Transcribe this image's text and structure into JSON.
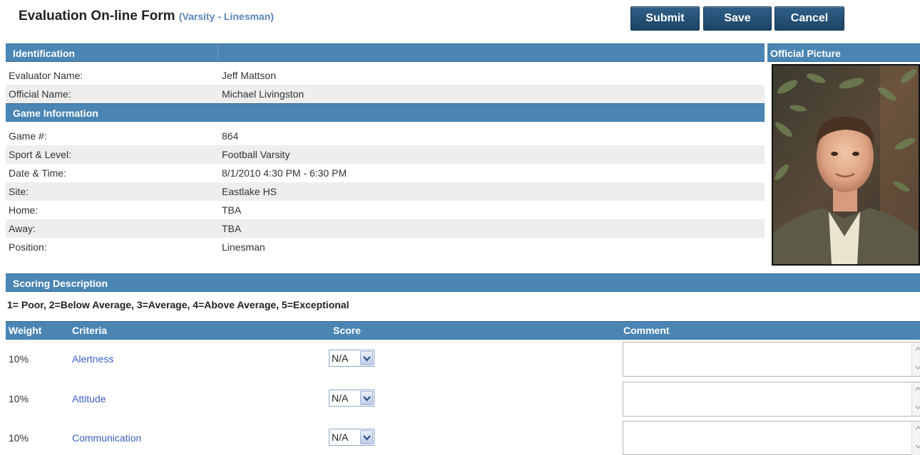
{
  "header": {
    "title": "Evaluation On-line Form",
    "subtitle_open": "(",
    "subtitle_sport": "Varsity",
    "subtitle_sep": " - ",
    "subtitle_position": "Linesman",
    "subtitle_close": ")"
  },
  "actions": {
    "submit_label": "Submit",
    "save_label": "Save",
    "cancel_label": "Cancel"
  },
  "identification": {
    "section_title": "Identification",
    "rows": [
      {
        "label": "Evaluator Name:",
        "value": "Jeff Mattson"
      },
      {
        "label": "Official Name:",
        "value": "Michael Livingston"
      }
    ]
  },
  "game_information": {
    "section_title": "Game Information",
    "rows": [
      {
        "label": "Game #:",
        "value": "864"
      },
      {
        "label": "Sport & Level:",
        "value": "Football Varsity"
      },
      {
        "label": "Date & Time:",
        "value": "8/1/2010 4:30 PM - 6:30 PM"
      },
      {
        "label": "Site:",
        "value": "Eastlake HS"
      },
      {
        "label": "Home:",
        "value": "TBA"
      },
      {
        "label": "Away:",
        "value": "TBA"
      },
      {
        "label": "Position:",
        "value": "Linesman"
      }
    ]
  },
  "picture": {
    "section_title": "Official Picture"
  },
  "scoring": {
    "section_title": "Scoring Description",
    "description": "1= Poor, 2=Below Average, 3=Average, 4=Above Average, 5=Exceptional",
    "columns": {
      "weight": "Weight",
      "criteria": "Criteria",
      "score": "Score",
      "comment": "Comment"
    },
    "criteria": [
      {
        "weight": "10%",
        "name": "Alertness",
        "score": "N/A"
      },
      {
        "weight": "10%",
        "name": "Attitude",
        "score": "N/A"
      },
      {
        "weight": "10%",
        "name": "Communication",
        "score": "N/A"
      }
    ]
  },
  "colors": {
    "section_bar": "#4a85b4",
    "button": "#1c4466",
    "link": "#3b5fc6",
    "subtitle": "#5a87b7"
  }
}
